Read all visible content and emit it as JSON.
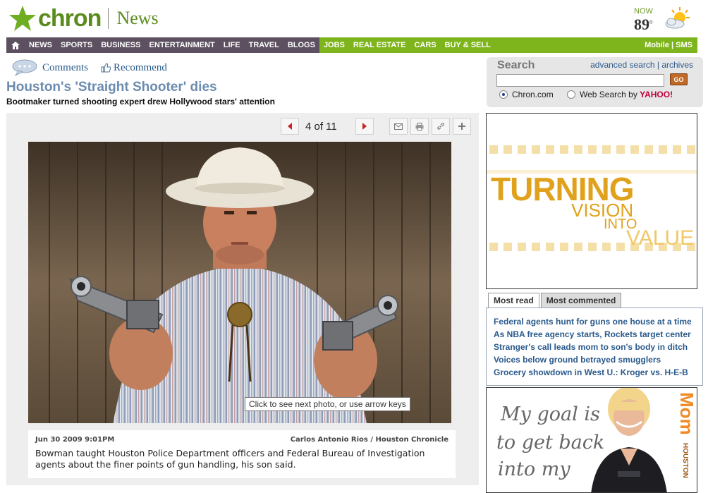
{
  "header": {
    "logo_text": "chron",
    "section": "News",
    "weather": {
      "label": "NOW",
      "temp": "89",
      "degree": "o",
      "icon": "sun-cloud-icon"
    }
  },
  "nav": {
    "main": [
      "NEWS",
      "SPORTS",
      "BUSINESS",
      "ENTERTAINMENT",
      "LIFE",
      "TRAVEL",
      "BLOGS"
    ],
    "secondary": [
      "JOBS",
      "REAL ESTATE",
      "CARS",
      "BUY & SELL"
    ],
    "right": "Mobile | SMS"
  },
  "article": {
    "comments_label": "Comments",
    "recommend_label": "Recommend",
    "headline": "Houston's 'Straight Shooter' dies",
    "subhead": "Bootmaker turned shooting expert drew Hollywood stars' attention"
  },
  "gallery": {
    "counter": "4 of 11",
    "tooltip": "Click to see next photo, or use arrow keys",
    "date": "Jun 30 2009 9:01PM",
    "credit": "Carlos Antonio Rios /  Houston Chronicle",
    "caption": "Bowman taught Houston Police Department officers and Federal Bureau of Investigation agents about the finer points of gun handling, his son said."
  },
  "search": {
    "title": "Search",
    "advanced": "advanced search",
    "sep": "|",
    "archives": "archives",
    "go": "GO",
    "option1": "Chron.com",
    "option2": "Web Search by",
    "yahoo": "YAHOO!"
  },
  "ad": {
    "line1": "TURNING",
    "line2": "VISION",
    "line3": "INTO",
    "line4": "VALUE"
  },
  "most_read": {
    "tab_active": "Most read",
    "tab_other": "Most commented",
    "items": [
      "Federal agents hunt for guns one house at a time",
      "As NBA free agency starts, Rockets target center",
      "Stranger's call leads mom to son's body in ditch",
      "Voices below ground betrayed smugglers",
      "Grocery showdown in West U.: Kroger vs. H-E-B"
    ]
  },
  "mom_ad": {
    "l1": "My goal is",
    "l2": "to get back",
    "l3": "into my",
    "brand": "Mom",
    "brand_sub": "HOUSTON"
  },
  "colors": {
    "nav_main": "#5d5060",
    "nav_secondary": "#7fb51c",
    "brand": "#5a8c1d",
    "link": "#2a5a8c"
  }
}
